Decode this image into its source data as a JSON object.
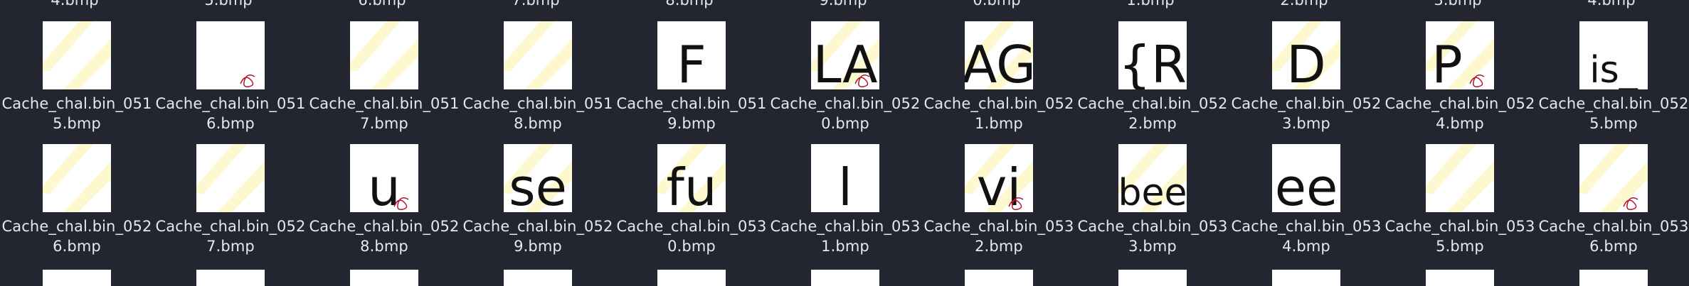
{
  "top_partial_labels": [
    "4.bmp",
    "5.bmp",
    "6.bmp",
    "7.bmp",
    "8.bmp",
    "9.bmp",
    "0.bmp",
    "1.bmp",
    "2.bmp",
    "3.bmp",
    "4.bmp"
  ],
  "rows": [
    {
      "items": [
        {
          "name_line1": "Cache_chal.bin_051",
          "name_line2": "5.bmp",
          "glyph": ""
        },
        {
          "name_line1": "Cache_chal.bin_051",
          "name_line2": "6.bmp",
          "glyph": ""
        },
        {
          "name_line1": "Cache_chal.bin_051",
          "name_line2": "7.bmp",
          "glyph": ""
        },
        {
          "name_line1": "Cache_chal.bin_051",
          "name_line2": "8.bmp",
          "glyph": ""
        },
        {
          "name_line1": "Cache_chal.bin_051",
          "name_line2": "9.bmp",
          "glyph": "F"
        },
        {
          "name_line1": "Cache_chal.bin_052",
          "name_line2": "0.bmp",
          "glyph": "LA"
        },
        {
          "name_line1": "Cache_chal.bin_052",
          "name_line2": "1.bmp",
          "glyph": "AG"
        },
        {
          "name_line1": "Cache_chal.bin_052",
          "name_line2": "2.bmp",
          "glyph": "{R"
        },
        {
          "name_line1": "Cache_chal.bin_052",
          "name_line2": "3.bmp",
          "glyph": "D"
        },
        {
          "name_line1": "Cache_chal.bin_052",
          "name_line2": "4.bmp",
          "glyph": "P_"
        },
        {
          "name_line1": "Cache_chal.bin_052",
          "name_line2": "5.bmp",
          "glyph": "is_"
        }
      ]
    },
    {
      "items": [
        {
          "name_line1": "Cache_chal.bin_052",
          "name_line2": "6.bmp",
          "glyph": ""
        },
        {
          "name_line1": "Cache_chal.bin_052",
          "name_line2": "7.bmp",
          "glyph": ""
        },
        {
          "name_line1": "Cache_chal.bin_052",
          "name_line2": "8.bmp",
          "glyph": "u"
        },
        {
          "name_line1": "Cache_chal.bin_052",
          "name_line2": "9.bmp",
          "glyph": "se"
        },
        {
          "name_line1": "Cache_chal.bin_053",
          "name_line2": "0.bmp",
          "glyph": "fu"
        },
        {
          "name_line1": "Cache_chal.bin_053",
          "name_line2": "1.bmp",
          "glyph": "l"
        },
        {
          "name_line1": "Cache_chal.bin_053",
          "name_line2": "2.bmp",
          "glyph": "vi"
        },
        {
          "name_line1": "Cache_chal.bin_053",
          "name_line2": "3.bmp",
          "glyph": "bee"
        },
        {
          "name_line1": "Cache_chal.bin_053",
          "name_line2": "4.bmp",
          "glyph": "ee"
        },
        {
          "name_line1": "Cache_chal.bin_053",
          "name_line2": "5.bmp",
          "glyph": ""
        },
        {
          "name_line1": "Cache_chal.bin_053",
          "name_line2": "6.bmp",
          "glyph": ""
        }
      ]
    }
  ],
  "colors": {
    "background": "#232530",
    "label_text": "#e8e8ec",
    "thumb_bg": "#ffffff",
    "stripe": "#fdf7c8",
    "ink": "#111111",
    "red_ink": "#b3122a"
  }
}
